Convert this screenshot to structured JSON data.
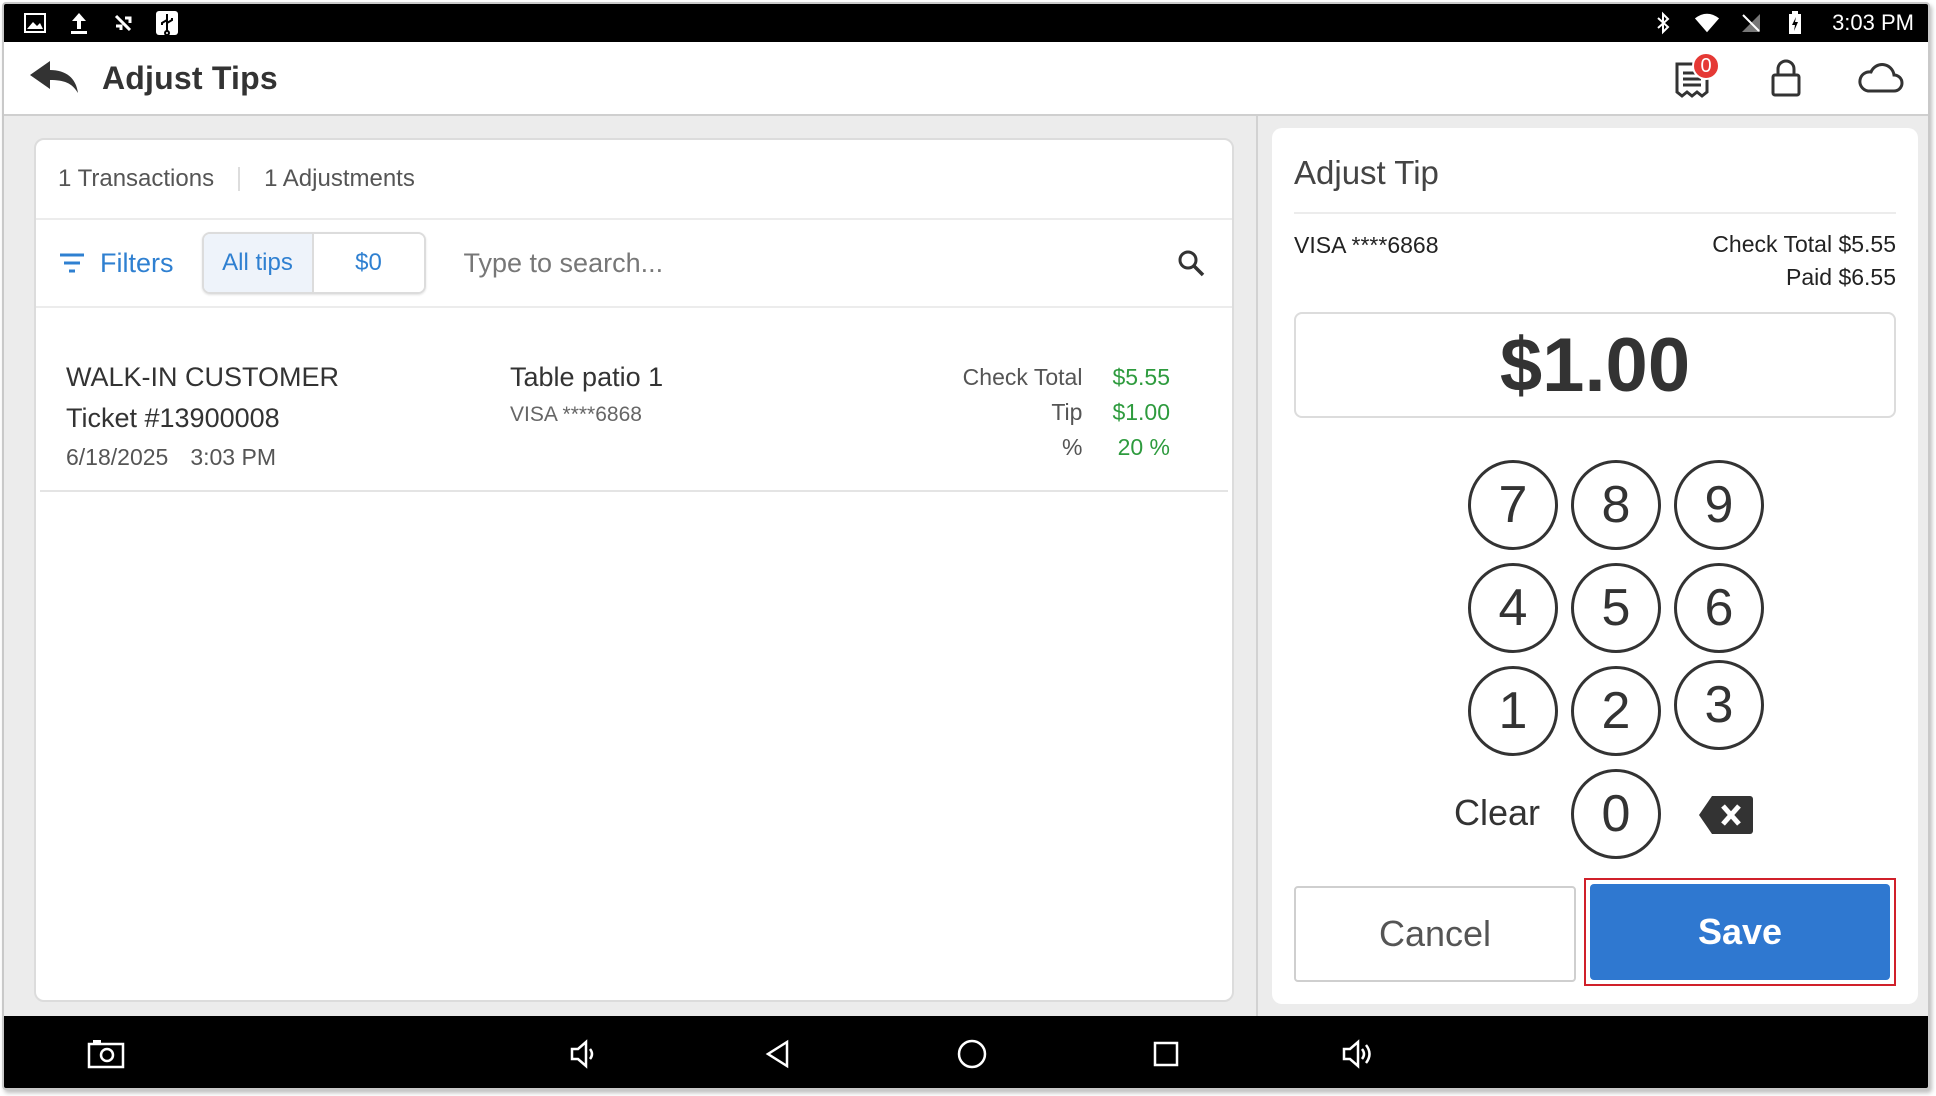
{
  "status_bar": {
    "time": "3:03 PM",
    "left_icons": [
      "gallery-icon",
      "upload-icon",
      "no-signal-icon",
      "usb-icon"
    ],
    "right_icons": [
      "bluetooth-icon",
      "wifi-icon",
      "cell-signal-icon",
      "battery-icon"
    ]
  },
  "app_bar": {
    "title": "Adjust Tips",
    "receipt_badge": "0"
  },
  "summary": {
    "transactions": "1 Transactions",
    "adjustments": "1 Adjustments"
  },
  "filters": {
    "filters_label": "Filters",
    "segments": [
      "All tips",
      "$0"
    ],
    "active_segment": "All tips",
    "search_placeholder": "Type to search...",
    "search_value": ""
  },
  "transactions": [
    {
      "customer": "WALK-IN CUSTOMER",
      "ticket": "Ticket #13900008",
      "date": "6/18/2025",
      "time": "3:03 PM",
      "table": "Table patio 1",
      "card": "VISA ****6868",
      "check_total_label": "Check Total",
      "check_total": "$5.55",
      "tip_label": "Tip",
      "tip": "$1.00",
      "percent_label": "%",
      "percent": "20 %"
    }
  ],
  "adjust_tip": {
    "title": "Adjust Tip",
    "card": "VISA ****6868",
    "check_total": "Check Total $5.55",
    "paid": "Paid $6.55",
    "amount": "$1.00",
    "keys": [
      "7",
      "8",
      "9",
      "4",
      "5",
      "6",
      "1",
      "2",
      "3",
      "0"
    ],
    "clear_label": "Clear",
    "cancel_label": "Cancel",
    "save_label": "Save"
  },
  "colors": {
    "accent_blue": "#2f80d1",
    "save_blue": "#2f78d0",
    "amount_green": "#2e9b3e",
    "badge_red": "#e53935",
    "highlight_red": "#d0202a"
  }
}
